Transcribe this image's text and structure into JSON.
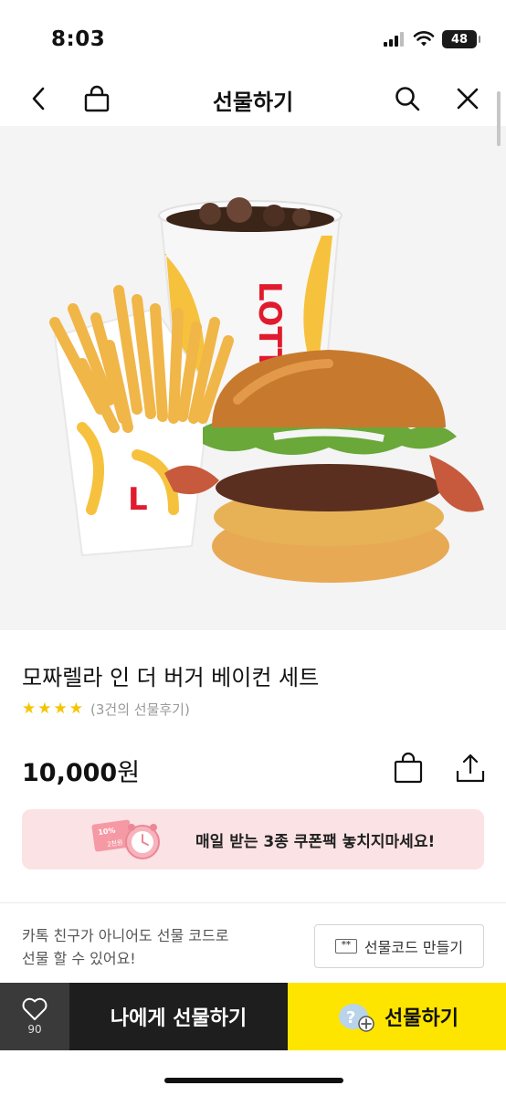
{
  "status_bar": {
    "time": "8:03",
    "battery": "48"
  },
  "header": {
    "title": "선물하기",
    "icons": [
      "back-icon",
      "shopping-bag-icon",
      "search-icon",
      "close-icon"
    ]
  },
  "product": {
    "name": "모짜렐라 인 더 버거 베이컨 세트",
    "rating_stars": 4,
    "review_text": "(3건의 선물후기)",
    "price_number": "10,000",
    "price_unit": "원"
  },
  "coupon_banner": {
    "text": "매일 받는 3종 쿠폰팩 놓치지마세요!",
    "badge_percent": "10%",
    "badge_amount": "2천원"
  },
  "gift_code": {
    "description_line1": "카톡 친구가 아니어도 선물 코드로",
    "description_line2": "선물 할 수 있어요!",
    "button_label": "선물코드 만들기",
    "icon_text": "**"
  },
  "bottom_bar": {
    "wish_count": "90",
    "gift_self_label": "나에게 선물하기",
    "gift_label": "선물하기"
  },
  "colors": {
    "kakao_yellow": "#fee500",
    "dark": "#1e1e1e",
    "star": "#f5c400",
    "banner_pink": "#fbe2e4"
  }
}
